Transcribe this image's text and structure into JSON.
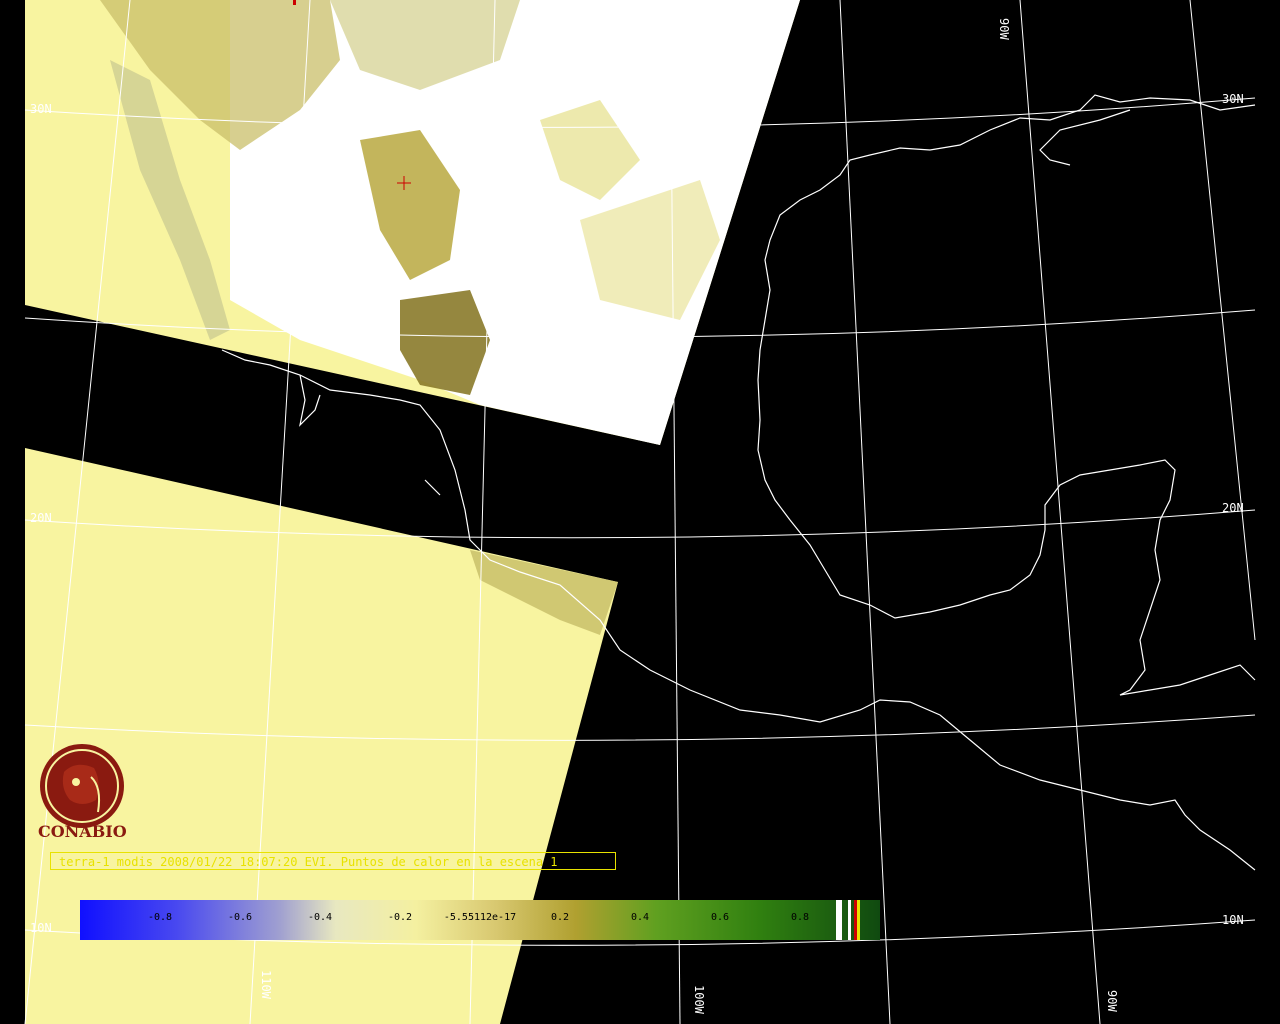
{
  "map": {
    "grid_labels": {
      "lat_30n_left": "30N",
      "lat_30n_right": "30N",
      "lat_20n_left": "20N",
      "lat_20n_right": "20N",
      "lat_10n_left": "10N",
      "lat_10n_right": "10N",
      "lon_90w_top": "90W",
      "lon_100w_bottom": "100W",
      "lon_110w_bottom": "110W",
      "lon_90w_bottom": "90W"
    },
    "colors": {
      "background": "#000000",
      "swath_yellow": "#f8f4a0",
      "cloud_white": "#ffffff",
      "vegetation": "#b8a840",
      "coastline": "#ffffff",
      "grid": "#ffffff",
      "caption": "#e8e200",
      "logo": "#8a1a10"
    }
  },
  "logo": {
    "text": "CONABIO"
  },
  "caption": {
    "text": "terra-1 modis 2008/01/22 18:07:20 EVI. Puntos de calor en la escena 1"
  },
  "colorbar": {
    "ticks": [
      "-0.8",
      "-0.6",
      "-0.4",
      "-0.2",
      "-5.55112e-17",
      "0.2",
      "0.4",
      "0.6",
      "0.8"
    ],
    "stops": [
      "#1010ff",
      "#7878e0",
      "#c8c8d0",
      "#f4f0a0",
      "#e0d060",
      "#b0a030",
      "#60a020",
      "#308010",
      "#106010"
    ]
  }
}
